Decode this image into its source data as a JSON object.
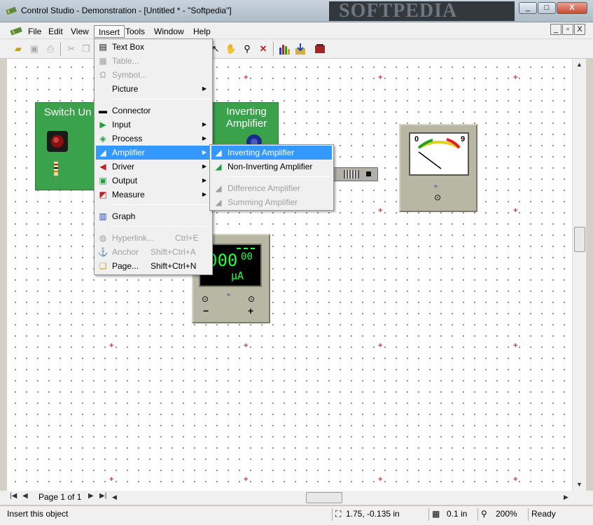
{
  "window": {
    "title": "Control Studio - Demonstration - [Untitled * - \"Softpedia\"]",
    "watermark": "SOFTPEDIA",
    "controls": [
      "_",
      "□",
      "X"
    ]
  },
  "menubar": {
    "items": [
      {
        "label": "File"
      },
      {
        "label": "Edit"
      },
      {
        "label": "View"
      },
      {
        "label": "Insert"
      },
      {
        "label": "Tools"
      },
      {
        "label": "Window"
      },
      {
        "label": "Help"
      }
    ],
    "mdi_controls": [
      "_",
      "▫",
      "X"
    ]
  },
  "insert_menu": {
    "items": [
      {
        "label": "Text Box",
        "icon": "text-box-icon",
        "enabled": true
      },
      {
        "label": "Table...",
        "icon": "table-icon",
        "enabled": false
      },
      {
        "label": "Symbol...",
        "icon": "omega-icon",
        "enabled": false
      },
      {
        "label": "Picture",
        "icon": "",
        "enabled": true,
        "submenu": true
      },
      {
        "label": "Connector",
        "icon": "connector-icon",
        "enabled": true
      },
      {
        "label": "Input",
        "icon": "input-icon",
        "enabled": true,
        "submenu": true
      },
      {
        "label": "Process",
        "icon": "process-icon",
        "enabled": true,
        "submenu": true
      },
      {
        "label": "Amplifier",
        "icon": "amplifier-icon",
        "enabled": true,
        "submenu": true,
        "highlighted": true
      },
      {
        "label": "Driver",
        "icon": "driver-icon",
        "enabled": true,
        "submenu": true
      },
      {
        "label": "Output",
        "icon": "output-icon",
        "enabled": true,
        "submenu": true
      },
      {
        "label": "Measure",
        "icon": "measure-icon",
        "enabled": true,
        "submenu": true
      },
      {
        "label": "Graph",
        "icon": "graph-icon",
        "enabled": true
      },
      {
        "label": "Hyperlink...",
        "shortcut": "Ctrl+E",
        "icon": "hyperlink-icon",
        "enabled": false
      },
      {
        "label": "Anchor",
        "shortcut": "Shift+Ctrl+A",
        "icon": "anchor-icon",
        "enabled": false
      },
      {
        "label": "Page...",
        "shortcut": "Shift+Ctrl+N",
        "icon": "page-icon",
        "enabled": true
      }
    ]
  },
  "amplifier_submenu": {
    "items": [
      {
        "label": "Inverting Amplifier",
        "enabled": true,
        "highlighted": true
      },
      {
        "label": "Non-Inverting Amplifier",
        "enabled": true
      },
      {
        "label": "Difference Amplifier",
        "enabled": false
      },
      {
        "label": "Summing Amplifier",
        "enabled": false
      }
    ]
  },
  "canvas": {
    "switch_unit_label": "Switch Un",
    "inverting_amp_label": "Inverting Amplifier",
    "meter_min": "0",
    "meter_max": "9",
    "lcd_value": "000",
    "lcd_exp": "00",
    "lcd_unit": "μA",
    "lcd_minus": "−",
    "lcd_plus": "+"
  },
  "navigation": {
    "page_label": "Page 1 of 1"
  },
  "statusbar": {
    "message": "Insert this object",
    "coordinates": "1.75, -0.135 in",
    "grid": "0.1 in",
    "zoom": "200%",
    "state": "Ready"
  },
  "colors": {
    "menu_highlight": "#3399ff",
    "component_green": "#3aa24a",
    "lcd_green": "#20ff40",
    "grid_marker": "#e03030"
  }
}
